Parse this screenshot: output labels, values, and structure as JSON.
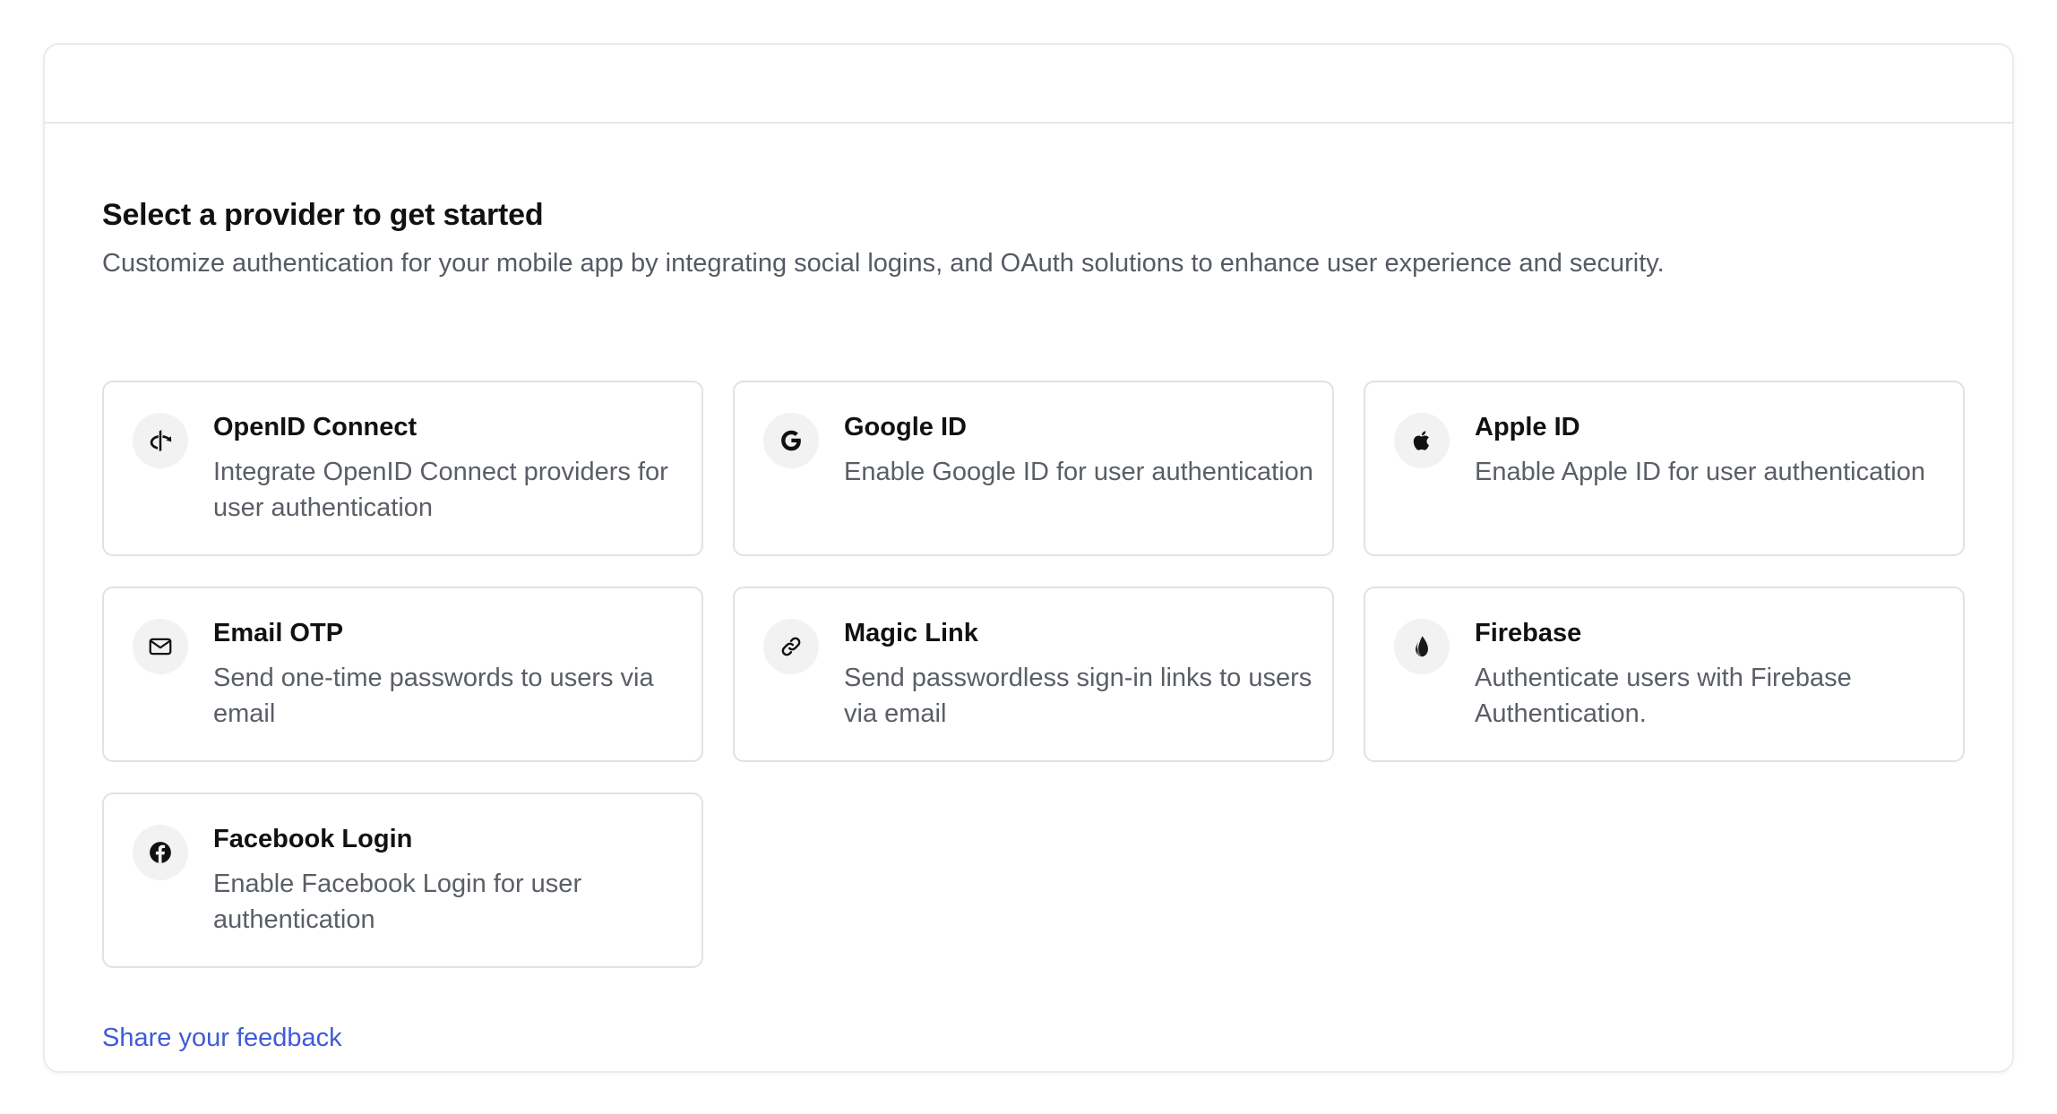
{
  "heading": "Select a provider to get started",
  "subheading": "Customize authentication for your mobile app by integrating social logins, and OAuth solutions to enhance user experience and security.",
  "providers": [
    {
      "title": "OpenID Connect",
      "description": "Integrate OpenID Connect providers for user authentication",
      "icon": "openid-icon"
    },
    {
      "title": "Google ID",
      "description": "Enable Google ID for user authentication",
      "icon": "google-icon"
    },
    {
      "title": "Apple ID",
      "description": "Enable Apple ID for user authentication",
      "icon": "apple-icon"
    },
    {
      "title": "Email OTP",
      "description": "Send one-time passwords to users via email",
      "icon": "mail-icon"
    },
    {
      "title": "Magic Link",
      "description": "Send passwordless sign-in links to users via email",
      "icon": "link-icon"
    },
    {
      "title": "Firebase",
      "description": "Authenticate users with Firebase Authentication.",
      "icon": "firebase-icon"
    },
    {
      "title": "Facebook Login",
      "description": "Enable Facebook Login for user authentication",
      "icon": "facebook-icon"
    }
  ],
  "feedback_link": "Share your feedback",
  "colors": {
    "link": "#3f5bd8",
    "border": "#e2e2e2",
    "icon_bg": "#f2f2f3"
  }
}
